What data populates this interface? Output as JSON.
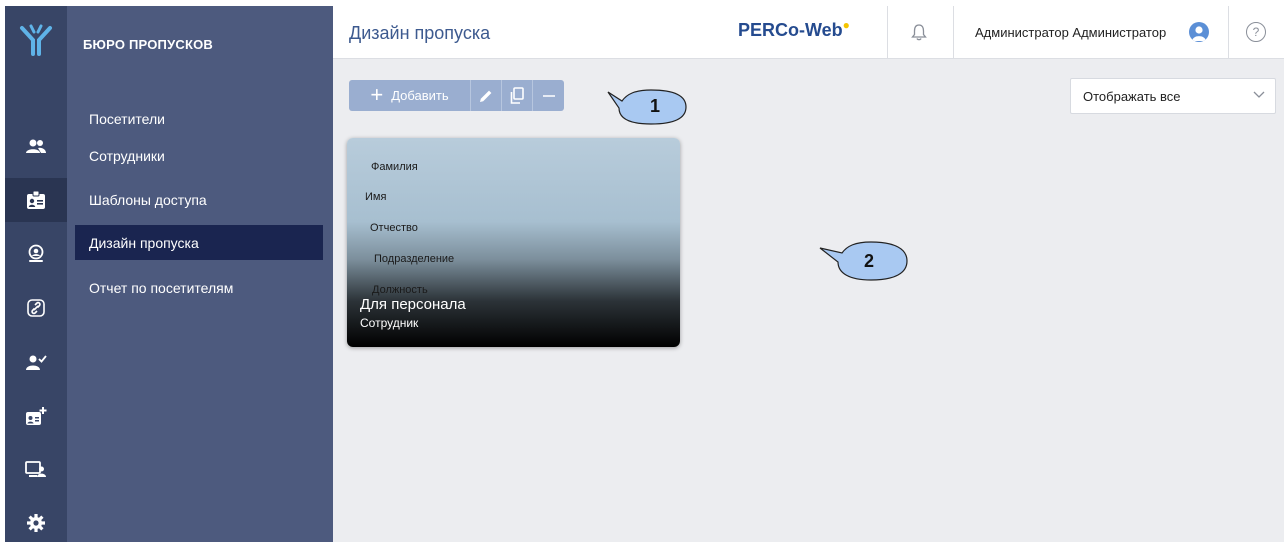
{
  "sidebar": {
    "title": "БЮРО ПРОПУСКОВ",
    "items": [
      {
        "label": "Посетители"
      },
      {
        "label": "Сотрудники"
      },
      {
        "label": "Шаблоны доступа"
      },
      {
        "label": "Дизайн пропуска"
      },
      {
        "label": "Отчет по посетителям"
      }
    ],
    "active_index": 3
  },
  "rail": {
    "icons": [
      "logo-icon",
      "people-icon",
      "id-card-icon",
      "visitor-search-icon",
      "link-icon",
      "person-check-icon",
      "id-card-add-icon",
      "monitor-person-icon",
      "gear-icon"
    ],
    "active_icon": "id-card-icon"
  },
  "header": {
    "title": "Дизайн пропуска",
    "brand": "PERCo-Web",
    "user_name": "Администратор Администратор",
    "help": "?"
  },
  "toolbar": {
    "add_label": "Добавить",
    "add_icon": "plus-icon",
    "edit_icon": "pencil-icon",
    "copy_icon": "copy-icon",
    "delete_icon": "minus-icon"
  },
  "filter": {
    "value": "Отображать все"
  },
  "cards": [
    {
      "fields": [
        "Фамилия",
        "Имя",
        "Отчество",
        "Подразделение",
        "Должность"
      ],
      "name": "Для персонала",
      "type": "Сотрудник"
    }
  ],
  "callouts": [
    "1",
    "2"
  ],
  "colors": {
    "rail": "#384566",
    "menu": "#4d5a7e",
    "menu_active": "#1a2550",
    "toolbar": "#9aaed0",
    "title": "#3d5a8f",
    "brand": "#254b8f",
    "brand_dot": "#f4c400",
    "callout": "#a9c9f2"
  }
}
